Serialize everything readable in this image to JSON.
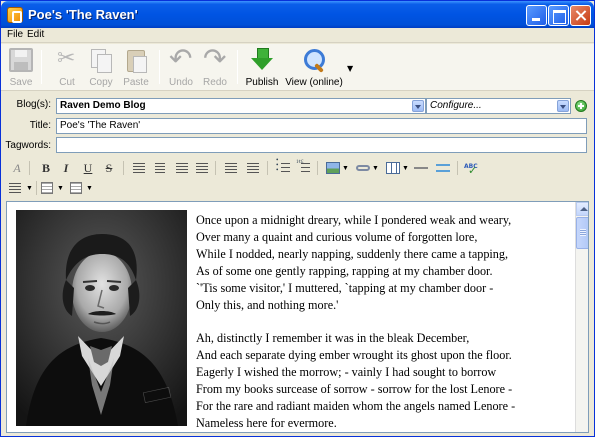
{
  "window": {
    "title": "Poe's 'The Raven'",
    "colors": {
      "titlebar": "#0054e3",
      "chrome": "#ece9d8",
      "accent_green": "#2f9f2a"
    }
  },
  "menu": [
    {
      "label": "File",
      "icon": null
    },
    {
      "label": "Edit",
      "icon": null
    }
  ],
  "toolbar": {
    "save": {
      "label": "Save",
      "icon": "save-disk-icon",
      "enabled": false
    },
    "cut": {
      "label": "Cut",
      "icon": "scissors-icon",
      "enabled": false
    },
    "copy": {
      "label": "Copy",
      "icon": "copy-icon",
      "enabled": false
    },
    "paste": {
      "label": "Paste",
      "icon": "clipboard-icon",
      "enabled": false
    },
    "undo": {
      "label": "Undo",
      "icon": "undo-arrow-icon",
      "enabled": false
    },
    "redo": {
      "label": "Redo",
      "icon": "redo-arrow-icon",
      "enabled": false
    },
    "publish": {
      "label": "Publish",
      "icon": "publish-arrow-icon",
      "enabled": true
    },
    "view": {
      "label": "View (online)",
      "icon": "magnifier-icon",
      "enabled": true
    }
  },
  "form": {
    "blogs": {
      "label": "Blog(s):",
      "value": "Raven Demo Blog"
    },
    "configure": {
      "value": "Configure..."
    },
    "title": {
      "label": "Title:",
      "value": "Poe's 'The Raven'"
    },
    "tagwords": {
      "label": "Tagwords:",
      "value": ""
    }
  },
  "formatting_toolbar": {
    "row1": [
      "clear-format",
      "bold",
      "italic",
      "underline",
      "strikethrough",
      "align-left",
      "align-center",
      "align-right",
      "justify",
      "outdent",
      "indent",
      "bullet-list",
      "numbered-list",
      "insert-image",
      "insert-link",
      "insert-table",
      "horizontal-rule",
      "split-post",
      "spell-check"
    ],
    "row2": [
      "paragraph-style",
      "text-box",
      "text-frame"
    ],
    "glyphs": {
      "clear": "A",
      "bold": "B",
      "italic": "I",
      "underline": "U",
      "strike": "S"
    }
  },
  "editor": {
    "image": {
      "alt": "Portrait of Edgar Allan Poe",
      "style": "black-and-white daguerreotype"
    },
    "stanzas": [
      [
        "Once upon a midnight dreary, while I pondered weak and weary,",
        "Over many a quaint and curious volume of forgotten lore,",
        "While I nodded, nearly napping, suddenly there came a tapping,",
        "As of some one gently rapping, rapping at my chamber door.",
        "`'Tis some visitor,' I muttered, `tapping at my chamber door -",
        "Only this, and nothing more.'"
      ],
      [
        "Ah, distinctly I remember it was in the bleak December,",
        "And each separate dying ember wrought its ghost upon the floor.",
        "Eagerly I wished the morrow; - vainly I had sought to borrow",
        "From my books surcease of sorrow - sorrow for the lost Lenore -",
        "For the rare and radiant maiden whom the angels named Lenore -",
        "Nameless here for evermore."
      ]
    ]
  }
}
